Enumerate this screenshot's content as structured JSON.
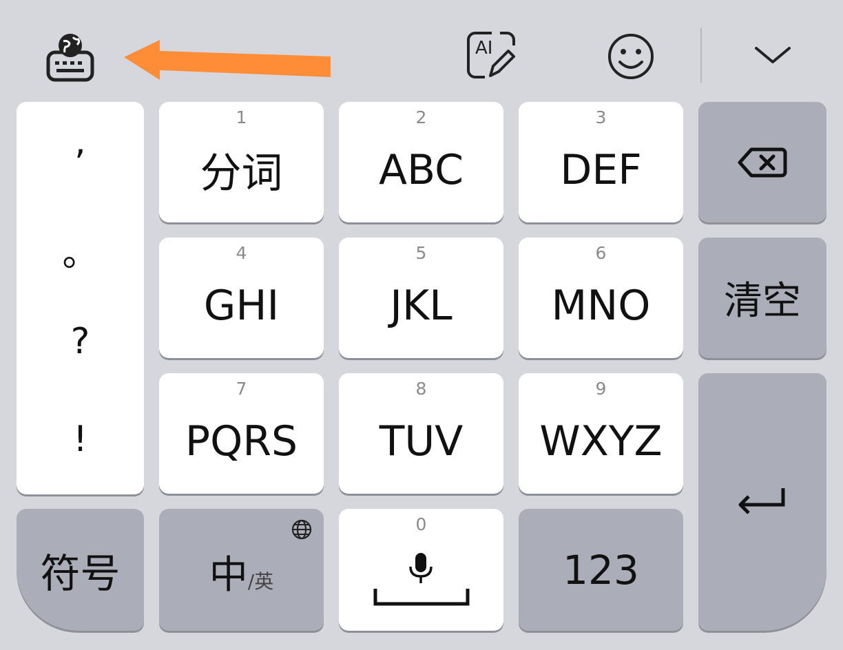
{
  "colors": {
    "background": "#d6d7dc",
    "key": "#ffffff",
    "function_key": "#abaeb8",
    "arrow": "#ff8c36",
    "icon": "#222222"
  },
  "toolbar": {
    "left_icon": "keyboard-globe-icon",
    "arrow_annotation": "orange-arrow-pointing-left",
    "ai_icon": "ai-write-icon",
    "ai_text": "AI",
    "emoji_icon": "smiley-icon",
    "collapse_icon": "chevron-down-icon"
  },
  "punctuation": [
    ",",
    "。",
    "?",
    "!"
  ],
  "keys": [
    {
      "num": "1",
      "label": "分词"
    },
    {
      "num": "2",
      "label": "ABC"
    },
    {
      "num": "3",
      "label": "DEF"
    },
    {
      "num": "4",
      "label": "GHI"
    },
    {
      "num": "5",
      "label": "JKL"
    },
    {
      "num": "6",
      "label": "MNO"
    },
    {
      "num": "7",
      "label": "PQRS"
    },
    {
      "num": "8",
      "label": "TUV"
    },
    {
      "num": "9",
      "label": "WXYZ"
    }
  ],
  "right_column": {
    "backspace_icon": "backspace-icon",
    "clear_label": "清空",
    "enter_icon": "enter-icon"
  },
  "bottom_row": {
    "symbols_label": "符号",
    "lang_main": "中",
    "lang_sub": "/英",
    "lang_icon": "globe-icon",
    "space_num": "0",
    "mic_icon": "microphone-icon",
    "space_icon": "space-bar-icon",
    "numbers_label": "123"
  }
}
